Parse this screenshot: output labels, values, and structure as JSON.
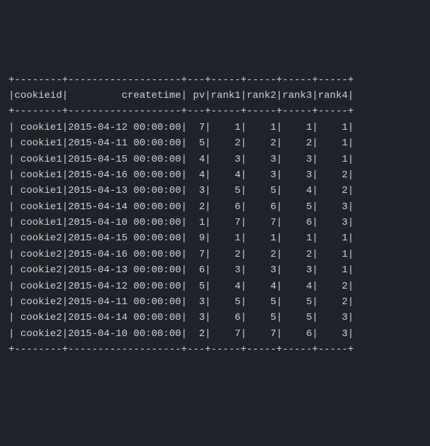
{
  "chart_data": {
    "type": "table",
    "border": "+--------+-------------------+---+-----+-----+-----+-----+",
    "columns": [
      "cookieid",
      "createtime",
      "pv",
      "rank1",
      "rank2",
      "rank3",
      "rank4"
    ],
    "rows": [
      {
        "cookieid": "cookie1",
        "createtime": "2015-04-12 00:00:00",
        "pv": 7,
        "rank1": 1,
        "rank2": 1,
        "rank3": 1,
        "rank4": 1
      },
      {
        "cookieid": "cookie1",
        "createtime": "2015-04-11 00:00:00",
        "pv": 5,
        "rank1": 2,
        "rank2": 2,
        "rank3": 2,
        "rank4": 1
      },
      {
        "cookieid": "cookie1",
        "createtime": "2015-04-15 00:00:00",
        "pv": 4,
        "rank1": 3,
        "rank2": 3,
        "rank3": 3,
        "rank4": 1
      },
      {
        "cookieid": "cookie1",
        "createtime": "2015-04-16 00:00:00",
        "pv": 4,
        "rank1": 4,
        "rank2": 3,
        "rank3": 3,
        "rank4": 2
      },
      {
        "cookieid": "cookie1",
        "createtime": "2015-04-13 00:00:00",
        "pv": 3,
        "rank1": 5,
        "rank2": 5,
        "rank3": 4,
        "rank4": 2
      },
      {
        "cookieid": "cookie1",
        "createtime": "2015-04-14 00:00:00",
        "pv": 2,
        "rank1": 6,
        "rank2": 6,
        "rank3": 5,
        "rank4": 3
      },
      {
        "cookieid": "cookie1",
        "createtime": "2015-04-10 00:00:00",
        "pv": 1,
        "rank1": 7,
        "rank2": 7,
        "rank3": 6,
        "rank4": 3
      },
      {
        "cookieid": "cookie2",
        "createtime": "2015-04-15 00:00:00",
        "pv": 9,
        "rank1": 1,
        "rank2": 1,
        "rank3": 1,
        "rank4": 1
      },
      {
        "cookieid": "cookie2",
        "createtime": "2015-04-16 00:00:00",
        "pv": 7,
        "rank1": 2,
        "rank2": 2,
        "rank3": 2,
        "rank4": 1
      },
      {
        "cookieid": "cookie2",
        "createtime": "2015-04-13 00:00:00",
        "pv": 6,
        "rank1": 3,
        "rank2": 3,
        "rank3": 3,
        "rank4": 1
      },
      {
        "cookieid": "cookie2",
        "createtime": "2015-04-12 00:00:00",
        "pv": 5,
        "rank1": 4,
        "rank2": 4,
        "rank3": 4,
        "rank4": 2
      },
      {
        "cookieid": "cookie2",
        "createtime": "2015-04-11 00:00:00",
        "pv": 3,
        "rank1": 5,
        "rank2": 5,
        "rank3": 5,
        "rank4": 2
      },
      {
        "cookieid": "cookie2",
        "createtime": "2015-04-14 00:00:00",
        "pv": 3,
        "rank1": 6,
        "rank2": 5,
        "rank3": 5,
        "rank4": 3
      },
      {
        "cookieid": "cookie2",
        "createtime": "2015-04-10 00:00:00",
        "pv": 2,
        "rank1": 7,
        "rank2": 7,
        "rank3": 6,
        "rank4": 3
      }
    ]
  }
}
